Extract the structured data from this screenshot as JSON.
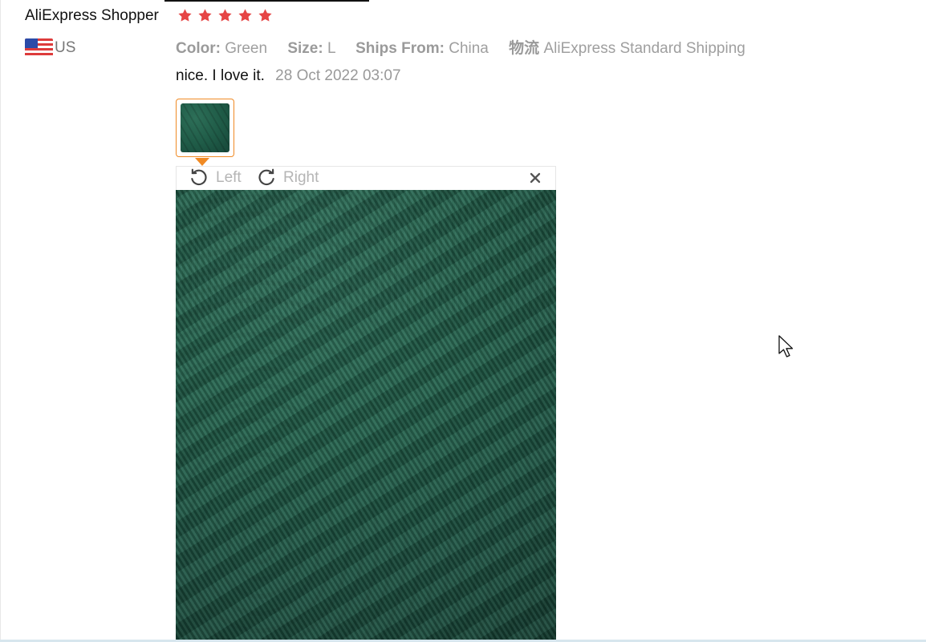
{
  "review": {
    "buyer_name": "AliExpress Shopper",
    "country": "US",
    "rating": 5,
    "star_color": "#e64545",
    "details": {
      "color_label": "Color:",
      "color_value": "Green",
      "size_label": "Size:",
      "size_value": "L",
      "ships_from_label": "Ships From:",
      "ships_from_value": "China",
      "logistics_label": "物流",
      "logistics_value": "AliExpress Standard Shipping"
    },
    "text": "nice. I love it.",
    "date": "28 Oct 2022 03:07"
  },
  "viewer": {
    "left_label": "Left",
    "right_label": "Right",
    "accent_color": "#f08a24"
  },
  "icons": {
    "flag": "us-flag-icon",
    "star": "star-icon",
    "rotate_left": "rotate-left-icon",
    "rotate_right": "rotate-right-icon",
    "close": "close-icon",
    "cursor": "mouse-cursor-icon"
  }
}
